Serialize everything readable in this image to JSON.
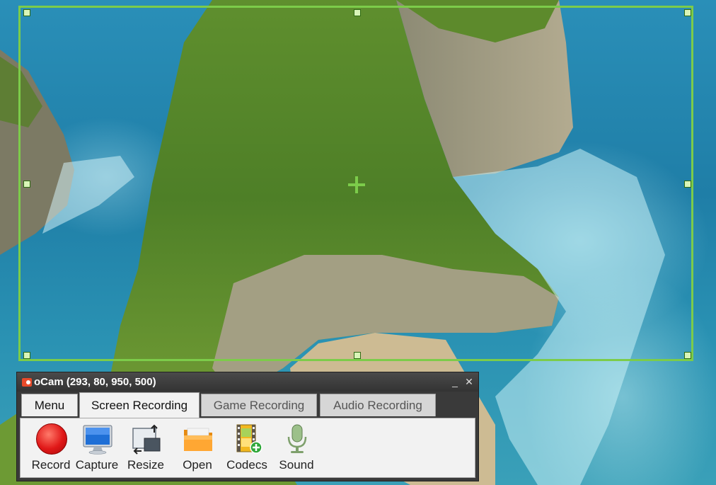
{
  "window": {
    "title": "oCam (293, 80, 950, 500)",
    "minimize_glyph": "_",
    "close_glyph": "✕"
  },
  "tabs": [
    {
      "label": "Menu"
    },
    {
      "label": "Screen Recording"
    },
    {
      "label": "Game Recording"
    },
    {
      "label": "Audio Recording"
    }
  ],
  "toolbar": {
    "items": [
      {
        "label": "Record",
        "icon": "record-icon"
      },
      {
        "label": "Capture",
        "icon": "monitor-icon"
      },
      {
        "label": "Resize",
        "icon": "resize-icon"
      },
      {
        "label": "Open",
        "icon": "folder-icon"
      },
      {
        "label": "Codecs",
        "icon": "codecs-icon"
      },
      {
        "label": "Sound",
        "icon": "microphone-icon"
      }
    ]
  },
  "colors": {
    "selection_frame": "#7ccc4a",
    "record_red": "#e01818"
  }
}
